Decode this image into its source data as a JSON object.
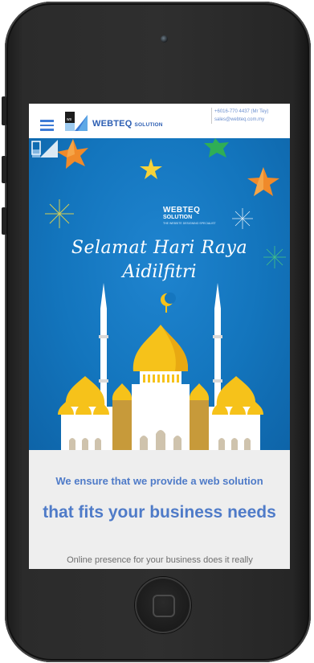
{
  "header": {
    "brand": "WEBTEQ",
    "brand_sub": "SOLUTION",
    "contact_phone": "+6016-770 4437 (Mr Tey)",
    "contact_email": "sales@webteq.com.my"
  },
  "banner": {
    "logo_name": "WEBTEQ",
    "logo_sub": "SOLUTION",
    "logo_tagline": "THE WEBSITE DESIGNING SPECIALIST",
    "greeting_line1": "Selamat Hari Raya",
    "greeting_line2": "Aidilfitri"
  },
  "content": {
    "heading_small": "We ensure that we provide a web solution",
    "heading_large": "that fits your business needs",
    "paragraph": "Online presence for your business does it really"
  },
  "colors": {
    "brand_blue": "#2d5fb3",
    "heading_blue": "#4f7bc8",
    "banner_blue": "#1375bd",
    "dome_gold": "#f6c21a"
  },
  "icons": [
    "hamburger-menu-icon",
    "webteq-logo-icon",
    "star-icon",
    "firework-icon",
    "mosque-illustration",
    "crescent-icon"
  ]
}
